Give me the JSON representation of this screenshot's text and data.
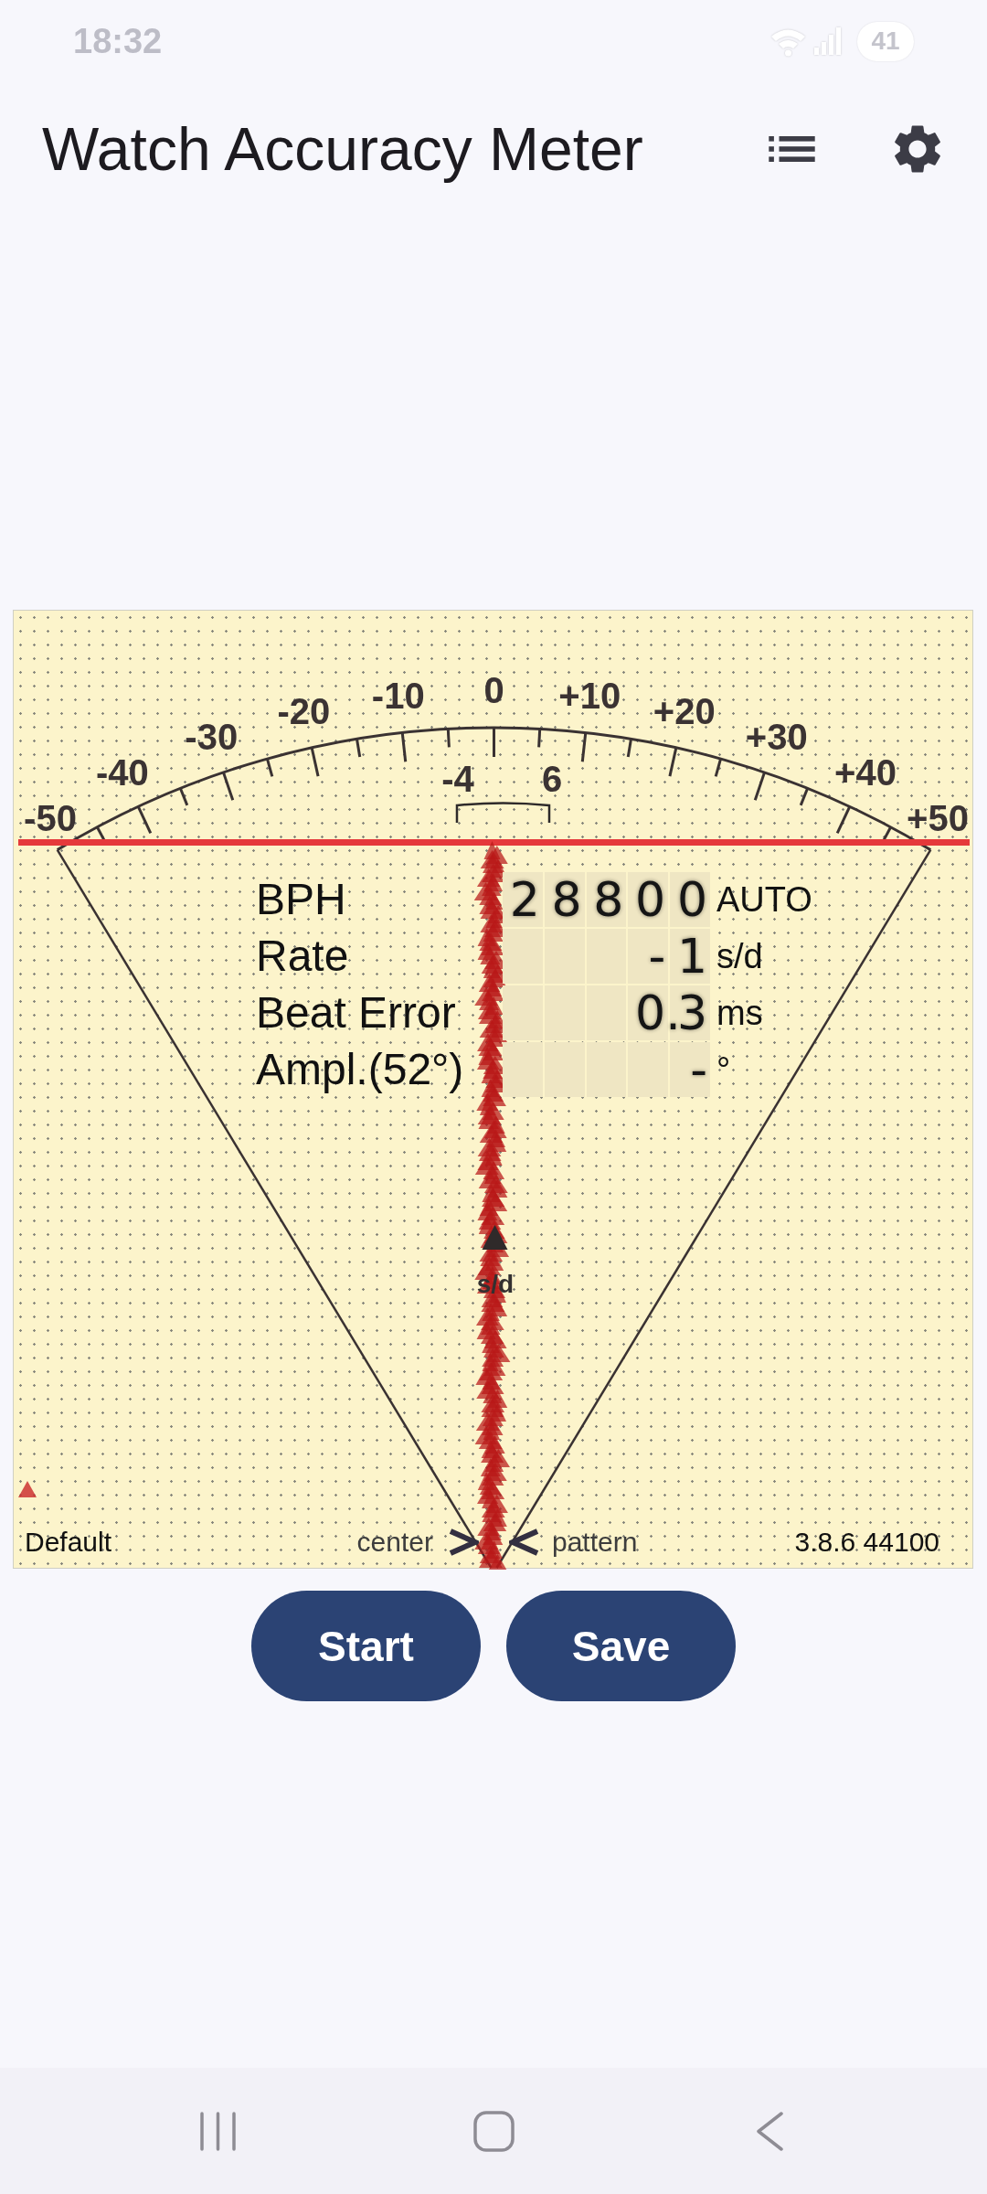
{
  "status_bar": {
    "time": "18:32",
    "battery": "41"
  },
  "app_bar": {
    "title": "Watch Accuracy Meter"
  },
  "meter": {
    "scale_labels": [
      "-50",
      "-40",
      "-30",
      "-20",
      "-10",
      "0",
      "+10",
      "+20",
      "+30",
      "+40",
      "+50"
    ],
    "tolerance": {
      "low": "-4",
      "high": "6"
    },
    "readings": [
      {
        "label": "BPH",
        "value": "28800",
        "unit": "AUTO"
      },
      {
        "label": "Rate",
        "value": "-1",
        "unit": "s/d"
      },
      {
        "label": "Beat Error",
        "value": "0.3",
        "unit": "ms"
      },
      {
        "label": "Ampl.(52°)",
        "value": "-",
        "unit": "°"
      }
    ],
    "rate_marker_label": "s/d",
    "profile": "Default",
    "center_label": "center",
    "pattern_label": "pattern",
    "version": "3.8.6 44100"
  },
  "buttons": [
    "Start",
    "Save"
  ]
}
